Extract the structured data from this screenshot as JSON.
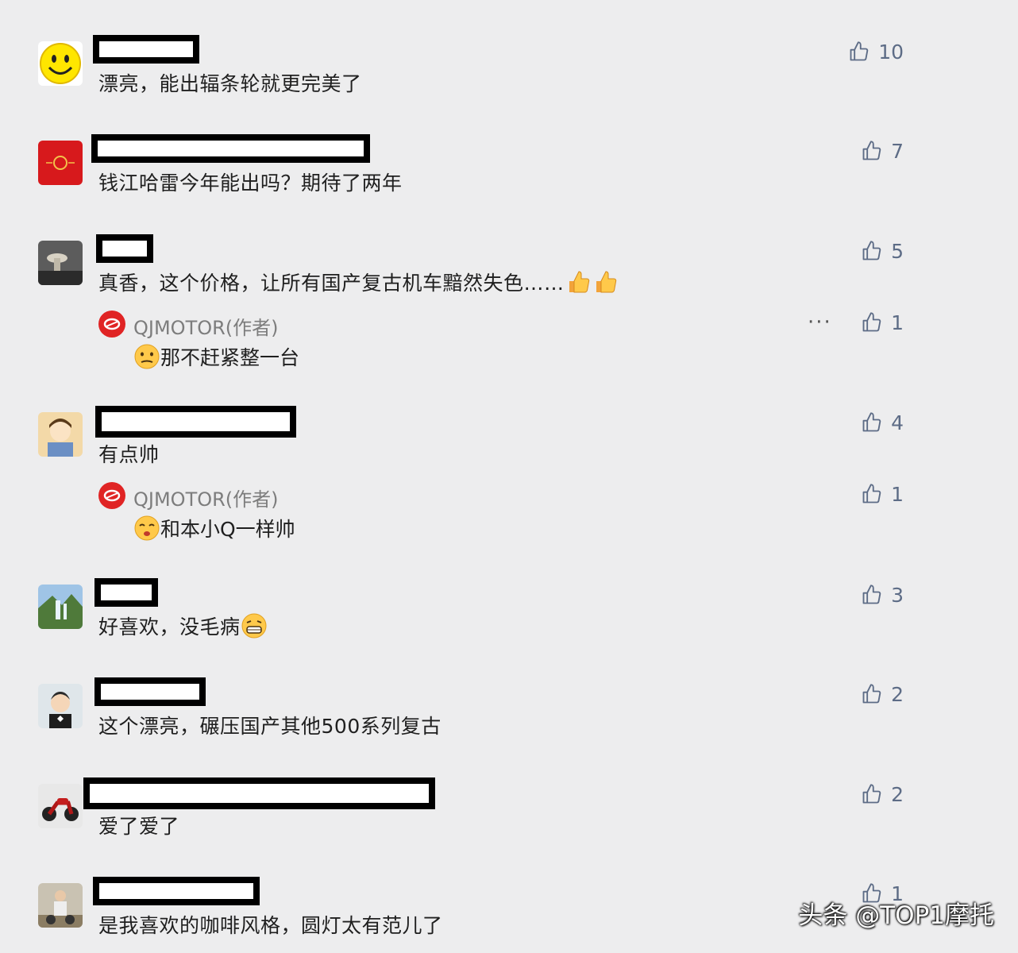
{
  "comments": [
    {
      "text": "漂亮，能出辐条轮就更完美了",
      "likes": "10",
      "avatar_icon": "smiley-face-icon"
    },
    {
      "text": "钱江哈雷今年能出吗？期待了两年",
      "likes": "7",
      "avatar_icon": "red-emblem-icon"
    },
    {
      "text": "真香，这个价格，让所有国产复古机车黯然失色……",
      "likes": "5",
      "avatar_icon": "photo-avatar-icon"
    },
    {
      "text": "有点帅",
      "likes": "4",
      "avatar_icon": "cartoon-boy-icon"
    },
    {
      "text": "好喜欢，没毛病",
      "likes": "3",
      "avatar_icon": "landscape-icon"
    },
    {
      "text": "这个漂亮，碾压国产其他500系列复古",
      "likes": "2",
      "avatar_icon": "cartoon-man-icon"
    },
    {
      "text": "爱了爱了",
      "likes": "2",
      "avatar_icon": "motorcycle-icon"
    },
    {
      "text": "是我喜欢的咖啡风格，圆灯太有范儿了",
      "likes": "1",
      "avatar_icon": "rider-photo-icon"
    }
  ],
  "replies": [
    {
      "author": "QJMOTOR(作者)",
      "text": "那不赶紧整一台",
      "likes": "1",
      "more": "···"
    },
    {
      "author": "QJMOTOR(作者)",
      "text": "和本小Q一样帅",
      "likes": "1"
    }
  ],
  "watermark": "头条 @TOP1摩托",
  "colors": {
    "background": "#ededee",
    "like": "#5d6c86",
    "brand": "#e02424"
  }
}
